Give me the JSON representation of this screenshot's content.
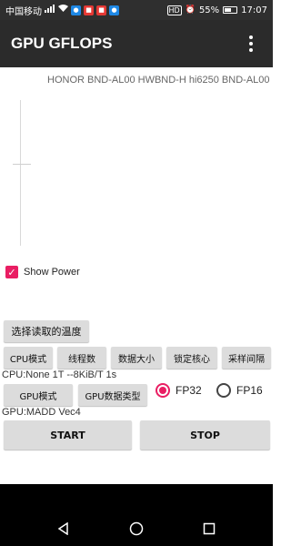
{
  "status_bar": {
    "carrier": "中国移动",
    "battery_percent": "55%",
    "battery_level": 0.55,
    "time": "17:07",
    "hd_label": "HD",
    "icons": [
      "signal-icon",
      "wifi-icon",
      "notification-icon-blue",
      "notification-icon-red",
      "notification-icon-red",
      "notification-icon-blue"
    ]
  },
  "app_bar": {
    "title": "GPU GFLOPS",
    "menu_icon": "overflow-menu-icon"
  },
  "device_info": "HONOR BND-AL00 HWBND-H hi6250 BND-AL00",
  "show_power": {
    "checked": true,
    "label": "Show Power"
  },
  "buttons": {
    "select_temp": "选择读取的温度",
    "cpu_mode": "CPU模式",
    "threads": "线程数",
    "data_size": "数据大小",
    "lock_core": "锁定核心",
    "sample_interval": "采样间隔",
    "gpu_mode": "GPU模式",
    "gpu_data_type": "GPU数据类型",
    "start": "START",
    "stop": "STOP"
  },
  "cpu_status": "CPU:None 1T --8KiB/T 1s",
  "gpu_status": "GPU:MADD Vec4",
  "precision": {
    "options": [
      "FP32",
      "FP16"
    ],
    "selected": "FP32"
  },
  "colors": {
    "accent": "#e91e63",
    "app_bar": "#2b2b2b",
    "button": "#dcdcdc"
  },
  "nav": [
    "back-icon",
    "home-icon",
    "recents-icon"
  ]
}
